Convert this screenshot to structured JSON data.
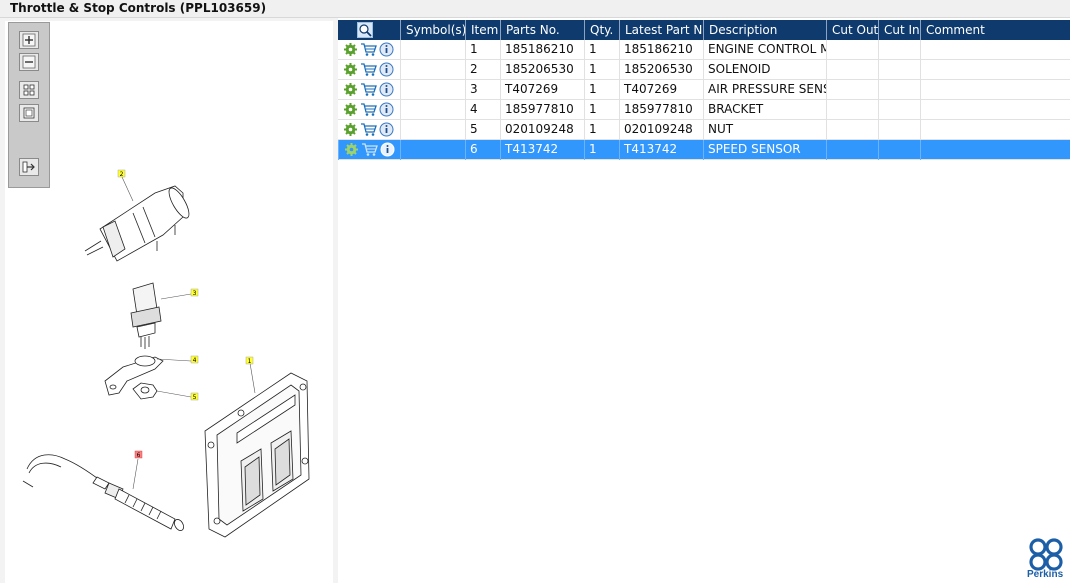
{
  "window": {
    "title": "Throttle & Stop Controls (PPL103659)"
  },
  "toolbar": {
    "buttons": [
      {
        "name": "zoom-in-button",
        "icon": "plus-icon"
      },
      {
        "name": "zoom-out-button",
        "icon": "minus-icon"
      },
      {
        "name": "fit-all-button",
        "icon": "grid-icon"
      },
      {
        "name": "fit-window-button",
        "icon": "square-icon"
      },
      {
        "name": "export-button",
        "icon": "export-arrow-icon"
      }
    ]
  },
  "diagram": {
    "callouts": [
      "2",
      "3",
      "4",
      "5",
      "1",
      "6"
    ]
  },
  "table": {
    "columns": [
      "",
      "Symbol(s)",
      "Item",
      "Parts No.",
      "Qty.",
      "Latest Part No.",
      "Description",
      "Cut Out",
      "Cut In",
      "Comment"
    ],
    "rows": [
      {
        "item": "1",
        "parts_no": "185186210",
        "qty": "1",
        "latest_part_no": "185186210",
        "description": "ENGINE CONTROL MOD",
        "cut_out": "",
        "cut_in": "",
        "comment": ""
      },
      {
        "item": "2",
        "parts_no": "185206530",
        "qty": "1",
        "latest_part_no": "185206530",
        "description": "SOLENOID",
        "cut_out": "",
        "cut_in": "",
        "comment": ""
      },
      {
        "item": "3",
        "parts_no": "T407269",
        "qty": "1",
        "latest_part_no": "T407269",
        "description": "AIR PRESSURE SENSOR",
        "cut_out": "",
        "cut_in": "",
        "comment": ""
      },
      {
        "item": "4",
        "parts_no": "185977810",
        "qty": "1",
        "latest_part_no": "185977810",
        "description": "BRACKET",
        "cut_out": "",
        "cut_in": "",
        "comment": ""
      },
      {
        "item": "5",
        "parts_no": "020109248",
        "qty": "1",
        "latest_part_no": "020109248",
        "description": "NUT",
        "cut_out": "",
        "cut_in": "",
        "comment": ""
      },
      {
        "item": "6",
        "parts_no": "T413742",
        "qty": "1",
        "latest_part_no": "T413742",
        "description": "SPEED SENSOR",
        "cut_out": "",
        "cut_in": "",
        "comment": "",
        "selected": true
      }
    ],
    "row_icons": [
      "gear-icon",
      "cart-icon",
      "info-icon"
    ],
    "header_icon": "search-zoom-icon"
  },
  "brand": {
    "name": "Perkins",
    "color": "#1d5fa6"
  },
  "colors": {
    "header": "#0e3a6e",
    "selected_row": "#3297fd",
    "callout": "#ffff33",
    "callout_selected": "#ff8080"
  }
}
